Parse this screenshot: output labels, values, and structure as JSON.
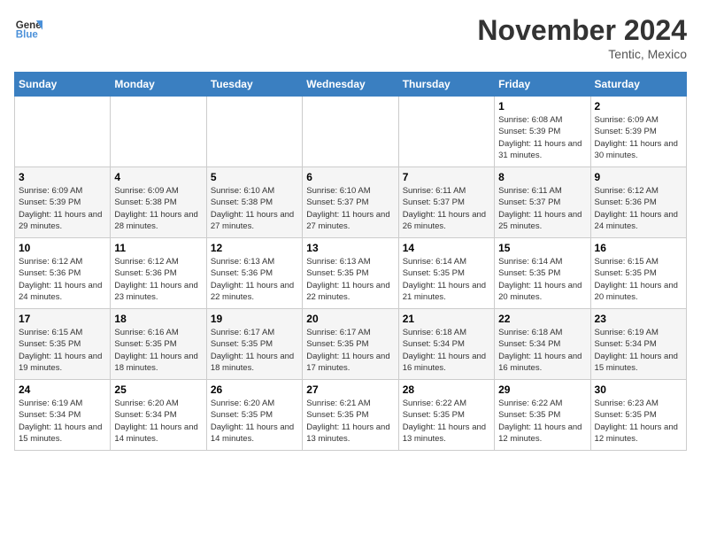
{
  "header": {
    "logo_line1": "General",
    "logo_line2": "Blue",
    "month": "November 2024",
    "location": "Tentic, Mexico"
  },
  "days_of_week": [
    "Sunday",
    "Monday",
    "Tuesday",
    "Wednesday",
    "Thursday",
    "Friday",
    "Saturday"
  ],
  "weeks": [
    [
      {
        "day": "",
        "detail": ""
      },
      {
        "day": "",
        "detail": ""
      },
      {
        "day": "",
        "detail": ""
      },
      {
        "day": "",
        "detail": ""
      },
      {
        "day": "",
        "detail": ""
      },
      {
        "day": "1",
        "detail": "Sunrise: 6:08 AM\nSunset: 5:39 PM\nDaylight: 11 hours and 31 minutes."
      },
      {
        "day": "2",
        "detail": "Sunrise: 6:09 AM\nSunset: 5:39 PM\nDaylight: 11 hours and 30 minutes."
      }
    ],
    [
      {
        "day": "3",
        "detail": "Sunrise: 6:09 AM\nSunset: 5:39 PM\nDaylight: 11 hours and 29 minutes."
      },
      {
        "day": "4",
        "detail": "Sunrise: 6:09 AM\nSunset: 5:38 PM\nDaylight: 11 hours and 28 minutes."
      },
      {
        "day": "5",
        "detail": "Sunrise: 6:10 AM\nSunset: 5:38 PM\nDaylight: 11 hours and 27 minutes."
      },
      {
        "day": "6",
        "detail": "Sunrise: 6:10 AM\nSunset: 5:37 PM\nDaylight: 11 hours and 27 minutes."
      },
      {
        "day": "7",
        "detail": "Sunrise: 6:11 AM\nSunset: 5:37 PM\nDaylight: 11 hours and 26 minutes."
      },
      {
        "day": "8",
        "detail": "Sunrise: 6:11 AM\nSunset: 5:37 PM\nDaylight: 11 hours and 25 minutes."
      },
      {
        "day": "9",
        "detail": "Sunrise: 6:12 AM\nSunset: 5:36 PM\nDaylight: 11 hours and 24 minutes."
      }
    ],
    [
      {
        "day": "10",
        "detail": "Sunrise: 6:12 AM\nSunset: 5:36 PM\nDaylight: 11 hours and 24 minutes."
      },
      {
        "day": "11",
        "detail": "Sunrise: 6:12 AM\nSunset: 5:36 PM\nDaylight: 11 hours and 23 minutes."
      },
      {
        "day": "12",
        "detail": "Sunrise: 6:13 AM\nSunset: 5:36 PM\nDaylight: 11 hours and 22 minutes."
      },
      {
        "day": "13",
        "detail": "Sunrise: 6:13 AM\nSunset: 5:35 PM\nDaylight: 11 hours and 22 minutes."
      },
      {
        "day": "14",
        "detail": "Sunrise: 6:14 AM\nSunset: 5:35 PM\nDaylight: 11 hours and 21 minutes."
      },
      {
        "day": "15",
        "detail": "Sunrise: 6:14 AM\nSunset: 5:35 PM\nDaylight: 11 hours and 20 minutes."
      },
      {
        "day": "16",
        "detail": "Sunrise: 6:15 AM\nSunset: 5:35 PM\nDaylight: 11 hours and 20 minutes."
      }
    ],
    [
      {
        "day": "17",
        "detail": "Sunrise: 6:15 AM\nSunset: 5:35 PM\nDaylight: 11 hours and 19 minutes."
      },
      {
        "day": "18",
        "detail": "Sunrise: 6:16 AM\nSunset: 5:35 PM\nDaylight: 11 hours and 18 minutes."
      },
      {
        "day": "19",
        "detail": "Sunrise: 6:17 AM\nSunset: 5:35 PM\nDaylight: 11 hours and 18 minutes."
      },
      {
        "day": "20",
        "detail": "Sunrise: 6:17 AM\nSunset: 5:35 PM\nDaylight: 11 hours and 17 minutes."
      },
      {
        "day": "21",
        "detail": "Sunrise: 6:18 AM\nSunset: 5:34 PM\nDaylight: 11 hours and 16 minutes."
      },
      {
        "day": "22",
        "detail": "Sunrise: 6:18 AM\nSunset: 5:34 PM\nDaylight: 11 hours and 16 minutes."
      },
      {
        "day": "23",
        "detail": "Sunrise: 6:19 AM\nSunset: 5:34 PM\nDaylight: 11 hours and 15 minutes."
      }
    ],
    [
      {
        "day": "24",
        "detail": "Sunrise: 6:19 AM\nSunset: 5:34 PM\nDaylight: 11 hours and 15 minutes."
      },
      {
        "day": "25",
        "detail": "Sunrise: 6:20 AM\nSunset: 5:34 PM\nDaylight: 11 hours and 14 minutes."
      },
      {
        "day": "26",
        "detail": "Sunrise: 6:20 AM\nSunset: 5:35 PM\nDaylight: 11 hours and 14 minutes."
      },
      {
        "day": "27",
        "detail": "Sunrise: 6:21 AM\nSunset: 5:35 PM\nDaylight: 11 hours and 13 minutes."
      },
      {
        "day": "28",
        "detail": "Sunrise: 6:22 AM\nSunset: 5:35 PM\nDaylight: 11 hours and 13 minutes."
      },
      {
        "day": "29",
        "detail": "Sunrise: 6:22 AM\nSunset: 5:35 PM\nDaylight: 11 hours and 12 minutes."
      },
      {
        "day": "30",
        "detail": "Sunrise: 6:23 AM\nSunset: 5:35 PM\nDaylight: 11 hours and 12 minutes."
      }
    ]
  ]
}
